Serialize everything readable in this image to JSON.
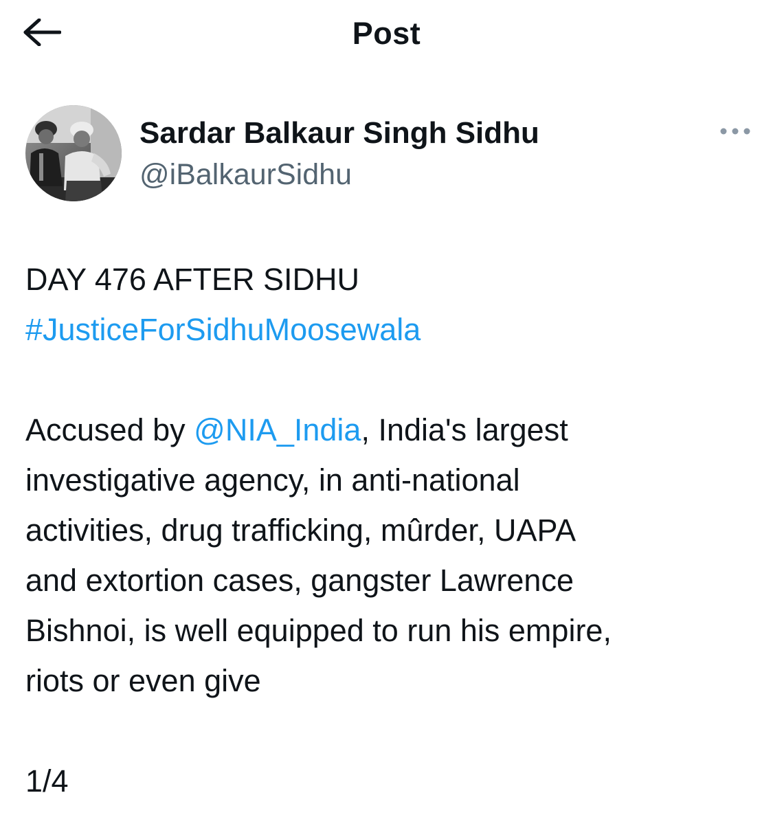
{
  "header": {
    "title": "Post",
    "back_icon": "arrow-left-icon"
  },
  "author": {
    "display_name": "Sardar Balkaur Singh Sidhu",
    "handle": "@iBalkaurSidhu",
    "avatar": "avatar-photo",
    "more_icon": "more-horizontal-icon"
  },
  "post": {
    "line1": "DAY 476 AFTER SIDHU",
    "hashtag": "#JusticeForSidhuMoosewala",
    "para_prefix": "Accused by ",
    "mention": "@NIA_India",
    "para_line1_suffix": ", India's largest",
    "para_line2": "investigative agency, in anti-national",
    "para_line3": "activities, drug trafficking, mûrder, UAPA",
    "para_line4": "and extortion cases, gangster Lawrence",
    "para_line5": "Bishnoi, is well equipped to run his empire,",
    "para_line6": "riots or even give",
    "thread_counter": "1/4"
  },
  "colors": {
    "link": "#1d9bf0",
    "text": "#0f1419",
    "secondary": "#536471"
  }
}
